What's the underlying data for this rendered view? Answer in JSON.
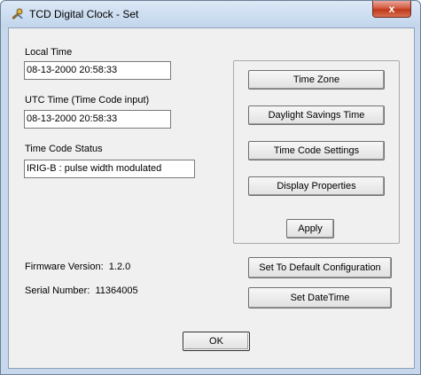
{
  "window": {
    "title": "TCD Digital Clock - Set",
    "close_glyph": "x",
    "icon": "app-tools-icon"
  },
  "local_time": {
    "label": "Local Time",
    "value": "08-13-2000  20:58:33"
  },
  "utc_time": {
    "label": "UTC Time (Time Code input)",
    "value": "08-13-2000  20:58:33"
  },
  "time_code_status": {
    "label": "Time Code Status",
    "value": "IRIG-B : pulse width modulated"
  },
  "settings_buttons": {
    "time_zone": "Time Zone",
    "daylight_savings": "Daylight Savings Time",
    "time_code_settings": "Time Code Settings",
    "display_properties": "Display Properties",
    "apply": "Apply"
  },
  "info": {
    "firmware_label": "Firmware Version:",
    "firmware_value": "1.2.0",
    "serial_label": "Serial Number:",
    "serial_value": "11364005"
  },
  "actions": {
    "set_default": "Set To Default Configuration",
    "set_datetime": "Set DateTime",
    "ok": "OK"
  },
  "colors": {
    "window_frame": "#c7d8ec",
    "close_button": "#c0381c",
    "client_background": "#f0f0f0"
  }
}
